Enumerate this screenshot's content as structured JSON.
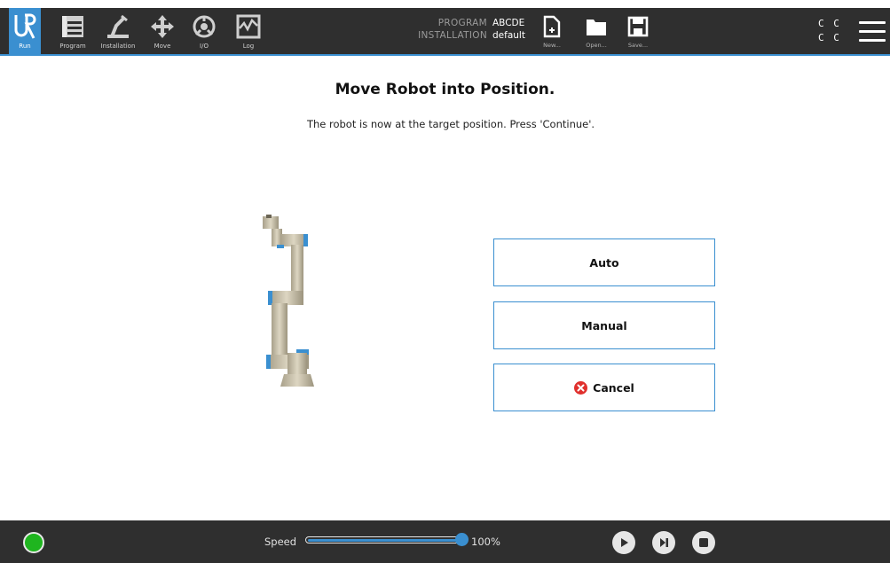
{
  "header": {
    "tabs": [
      {
        "label": "Run",
        "icon": "ur-logo-icon",
        "active": true
      },
      {
        "label": "Program",
        "icon": "program-icon"
      },
      {
        "label": "Installation",
        "icon": "installation-icon"
      },
      {
        "label": "Move",
        "icon": "move-arrows-icon"
      },
      {
        "label": "I/O",
        "icon": "io-icon"
      },
      {
        "label": "Log",
        "icon": "log-icon"
      }
    ],
    "program_key": "PROGRAM",
    "program_value": "ABCDE",
    "installation_key": "INSTALLATION",
    "installation_value": "default",
    "file_buttons": [
      {
        "label": "New...",
        "icon": "new-file-icon"
      },
      {
        "label": "Open...",
        "icon": "open-folder-icon"
      },
      {
        "label": "Save...",
        "icon": "save-icon"
      }
    ],
    "cc_line1": "C C",
    "cc_line2": "C C"
  },
  "main": {
    "title": "Move Robot into Position.",
    "message": "The robot is now at the target position. Press 'Continue'.",
    "buttons": {
      "auto": "Auto",
      "manual": "Manual",
      "cancel": "Cancel"
    }
  },
  "footer": {
    "speed_label": "Speed",
    "speed_value": "100%",
    "speed_fraction": 1.0,
    "status_color": "#1fb51f"
  },
  "colors": {
    "accent": "#3a8fd0",
    "bar": "#2f2f2f",
    "cancel_red": "#e0302d"
  }
}
